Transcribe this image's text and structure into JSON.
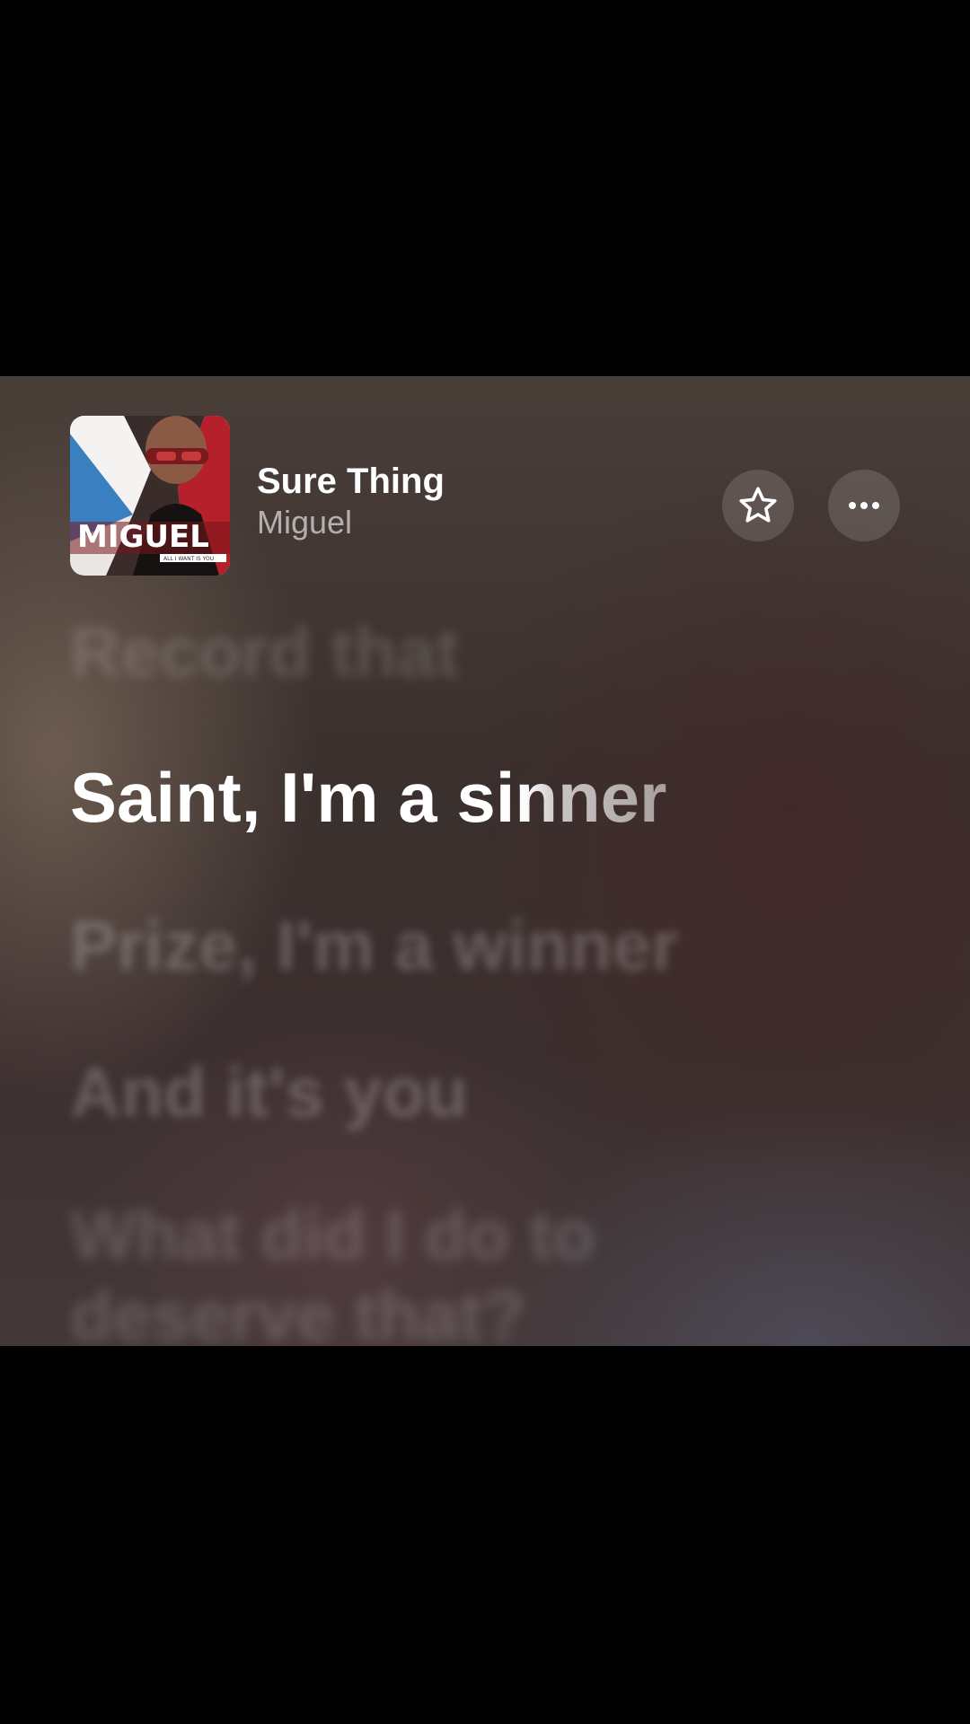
{
  "now_playing": {
    "title": "Sure Thing",
    "artist": "Miguel",
    "album_art": {
      "logo_text": "MIGUEL",
      "subtitle_text": "ALL I WANT IS YOU"
    }
  },
  "actions": {
    "favorite_icon": "star-outline-icon",
    "more_icon": "ellipsis-icon"
  },
  "lyrics": {
    "previous_line": "Record that",
    "current_line": "Saint, I'm a sinner",
    "upcoming_lines": [
      "Prize, I'm a winner",
      "And it's you",
      "What did I do to",
      "deserve that?"
    ]
  },
  "colors": {
    "background_top": "#4a3e39",
    "background_mid": "#3a302d",
    "text_active": "#ffffff",
    "text_secondary": "rgba(255,255,255,0.6)"
  }
}
